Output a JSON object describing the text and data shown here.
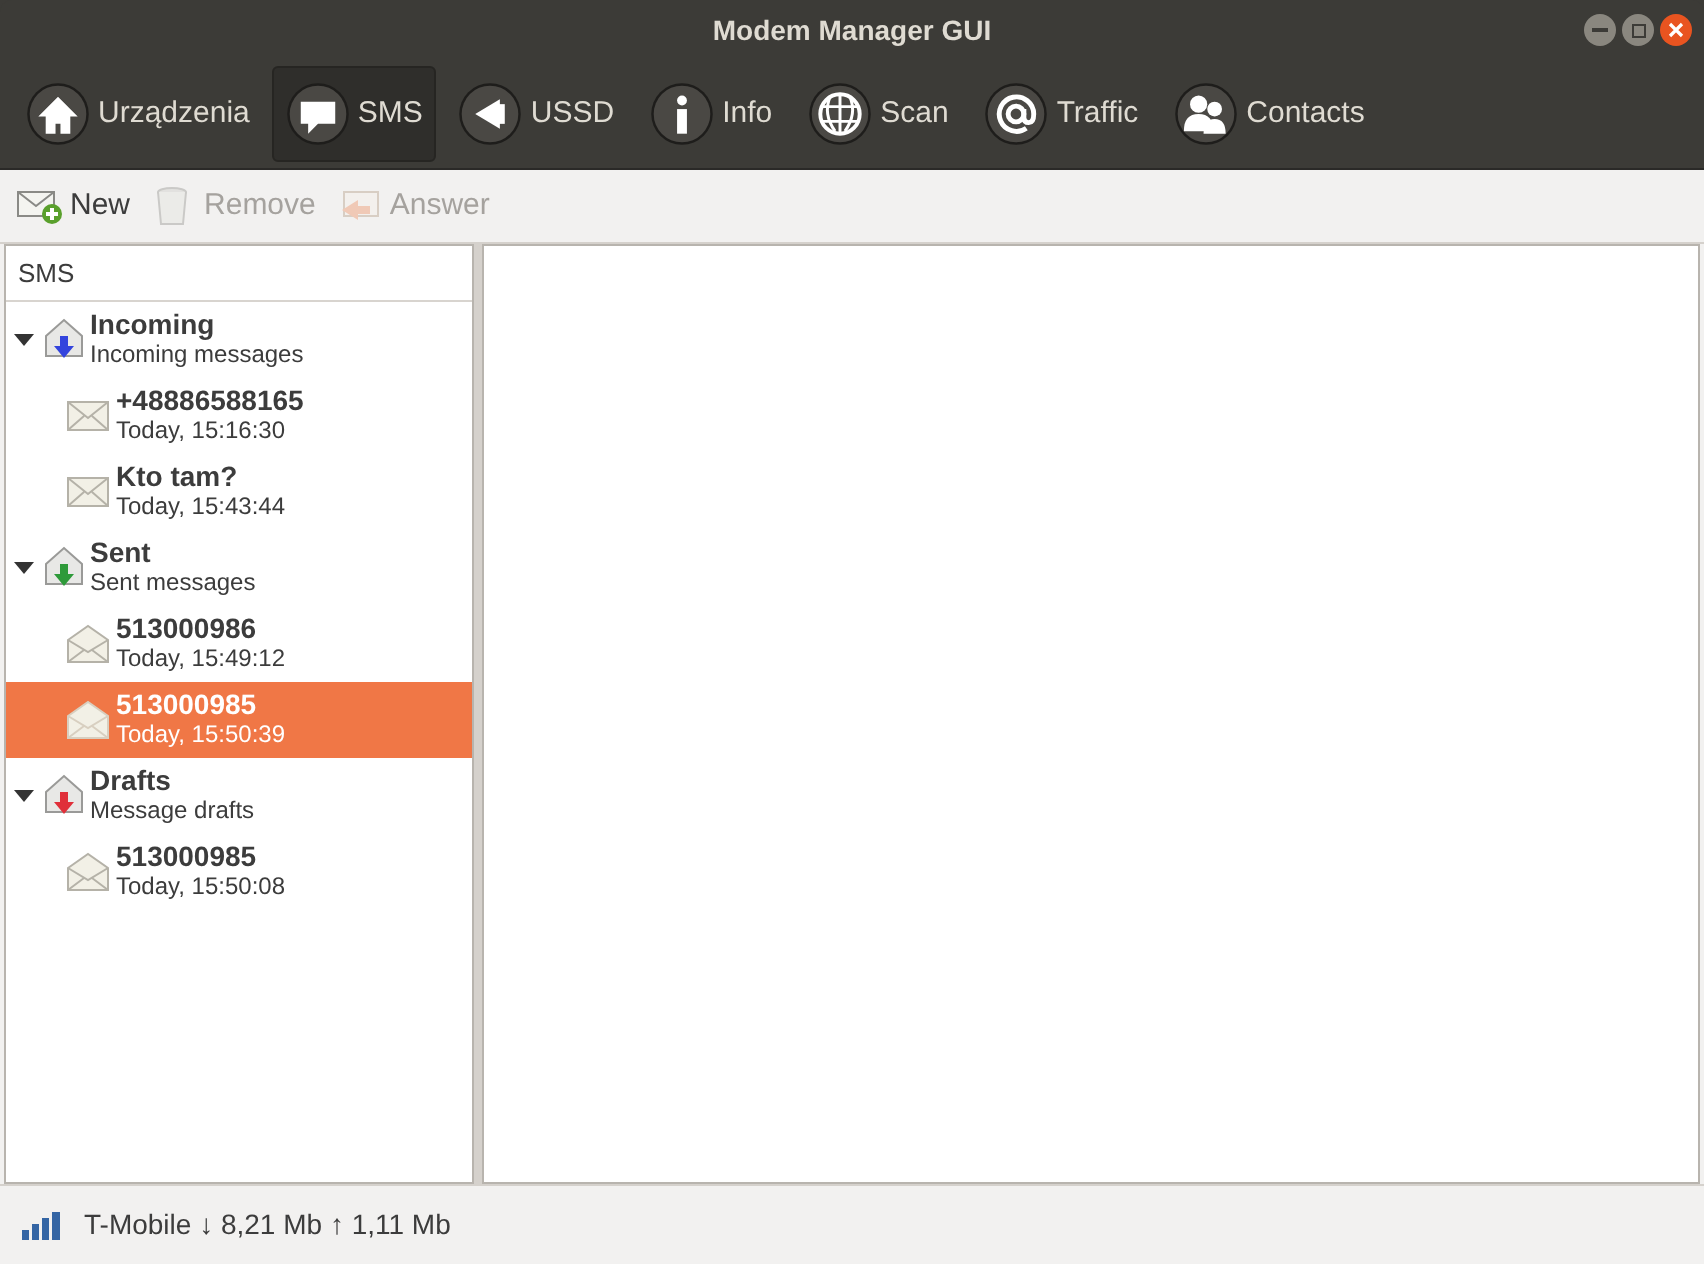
{
  "window": {
    "title": "Modem Manager GUI"
  },
  "nav": [
    {
      "label": "Urządzenia",
      "kind": "home",
      "selected": false
    },
    {
      "label": "SMS",
      "kind": "sms",
      "selected": true
    },
    {
      "label": "USSD",
      "kind": "ussd",
      "selected": false
    },
    {
      "label": "Info",
      "kind": "info",
      "selected": false
    },
    {
      "label": "Scan",
      "kind": "scan",
      "selected": false
    },
    {
      "label": "Traffic",
      "kind": "traffic",
      "selected": false
    },
    {
      "label": "Contacts",
      "kind": "contacts",
      "selected": false
    }
  ],
  "actions": [
    {
      "label": "New",
      "kind": "new",
      "disabled": false
    },
    {
      "label": "Remove",
      "kind": "remove",
      "disabled": true
    },
    {
      "label": "Answer",
      "kind": "answer",
      "disabled": true
    }
  ],
  "tree": {
    "header": "SMS",
    "folders": [
      {
        "title": "Incoming",
        "subtitle": "Incoming messages",
        "color": "#3344dd",
        "expanded": true,
        "children": [
          {
            "title": "+48886588165",
            "time": "Today, 15:16:30",
            "kind": "unread",
            "selected": false
          },
          {
            "title": "Kto tam?",
            "time": "Today, 15:43:44",
            "kind": "unread",
            "selected": false
          }
        ]
      },
      {
        "title": "Sent",
        "subtitle": "Sent messages",
        "color": "#2e9a3a",
        "expanded": true,
        "children": [
          {
            "title": "513000986",
            "time": "Today, 15:49:12",
            "kind": "read",
            "selected": false
          },
          {
            "title": "513000985",
            "time": "Today, 15:50:39",
            "kind": "read",
            "selected": true
          }
        ]
      },
      {
        "title": "Drafts",
        "subtitle": "Message drafts",
        "color": "#e0303a",
        "expanded": true,
        "children": [
          {
            "title": "513000985",
            "time": "Today, 15:50:08",
            "kind": "read",
            "selected": false
          }
        ]
      }
    ]
  },
  "status_bar": {
    "text": "T-Mobile ↓ 8,21 Mb ↑ 1,11 Mb"
  }
}
